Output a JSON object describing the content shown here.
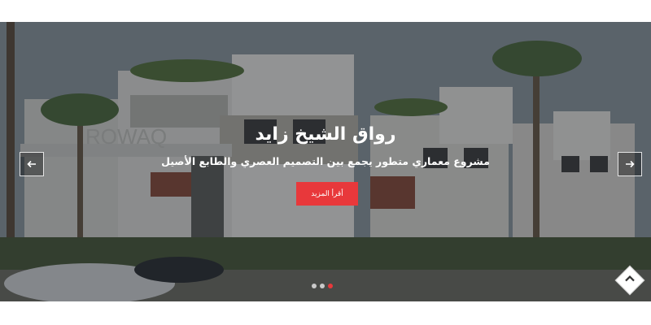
{
  "slider": {
    "title": "رواق الشيخ زايد",
    "subtitle": "مشروع معماري متطور يجمع بين التصميم العصري والطابع الأصيل",
    "button_label": "أقرأ المزيد",
    "sign_text": "ROWAQ",
    "slide_count": 3,
    "active_slide": 3
  },
  "icons": {
    "prev": "arrow-left-icon",
    "next": "arrow-right-icon",
    "scroll_top": "chevron-up-icon"
  },
  "colors": {
    "accent": "#e8383b",
    "overlay": "#14191e"
  }
}
